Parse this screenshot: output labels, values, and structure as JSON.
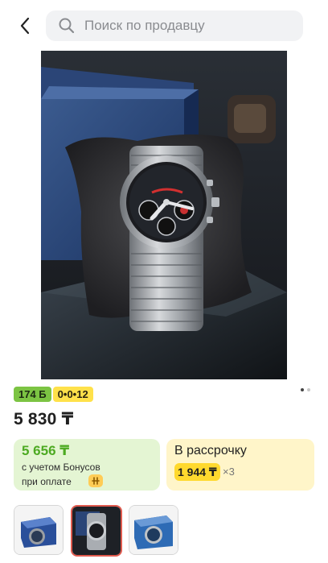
{
  "header": {
    "back_icon": "chevron-left-icon",
    "search_icon": "search-icon",
    "search_placeholder": "Поиск по продавцу"
  },
  "product": {
    "image_alt": "watch on pillow",
    "carousel": {
      "total": 2,
      "active_index": 0
    },
    "badges": [
      {
        "text": "174 Б",
        "color": "#7cc443"
      },
      {
        "text": "0•0•12",
        "color": "#ffe14a"
      }
    ],
    "price": "5 830 ₸"
  },
  "bonus_card": {
    "amount": "5 656 ₸",
    "line1": "с учетом Бонусов",
    "line2": "при оплате",
    "icon": "bonus-coin-icon"
  },
  "installment_card": {
    "title": "В рассрочку",
    "amount": "1 944 ₸",
    "multiplier": "×3"
  },
  "thumbnails": {
    "count": 3,
    "selected_index": 1
  }
}
